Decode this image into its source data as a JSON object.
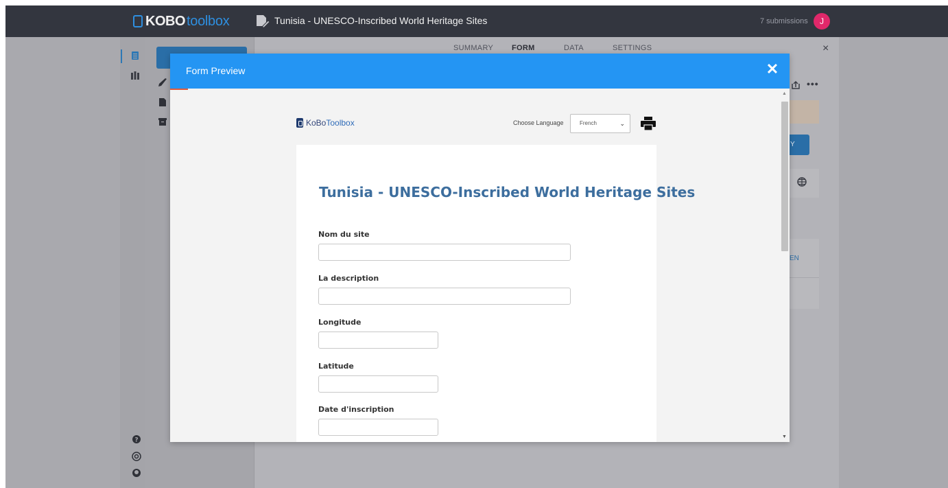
{
  "app": {
    "logo_bold": "KOBO",
    "logo_light": "toolbox",
    "form_title": "Tunisia - UNESCO-Inscribed World Heritage Sites",
    "submissions": "7 submissions",
    "avatar_initial": "J"
  },
  "tabs": [
    {
      "label": "SUMMARY",
      "active": false
    },
    {
      "label": "FORM",
      "active": true
    },
    {
      "label": "DATA",
      "active": false
    },
    {
      "label": "SETTINGS",
      "active": false
    }
  ],
  "background": {
    "close_glyph": "×",
    "side_button_fragment": "Y",
    "language_fragment": "EN",
    "more_glyph": "•••"
  },
  "modal": {
    "title": "Form Preview",
    "close_glyph": "✕"
  },
  "preview": {
    "logo_dark": "KoBo",
    "logo_light": "Toolbox",
    "language_label": "Choose Language",
    "language_selected": "French",
    "form_heading": "Tunisia - UNESCO-Inscribed World Heritage Sites",
    "questions": [
      {
        "label": "Nom du site",
        "value": ""
      },
      {
        "label": "La description",
        "value": ""
      },
      {
        "label": "Longitude",
        "value": ""
      },
      {
        "label": "Latitude",
        "value": ""
      },
      {
        "label": "Date d'inscription",
        "value": ""
      }
    ]
  },
  "colors": {
    "topbar": "#33363f",
    "modal_header": "#2495f3",
    "form_heading": "#3d6e9e",
    "avatar": "#e0286a"
  }
}
